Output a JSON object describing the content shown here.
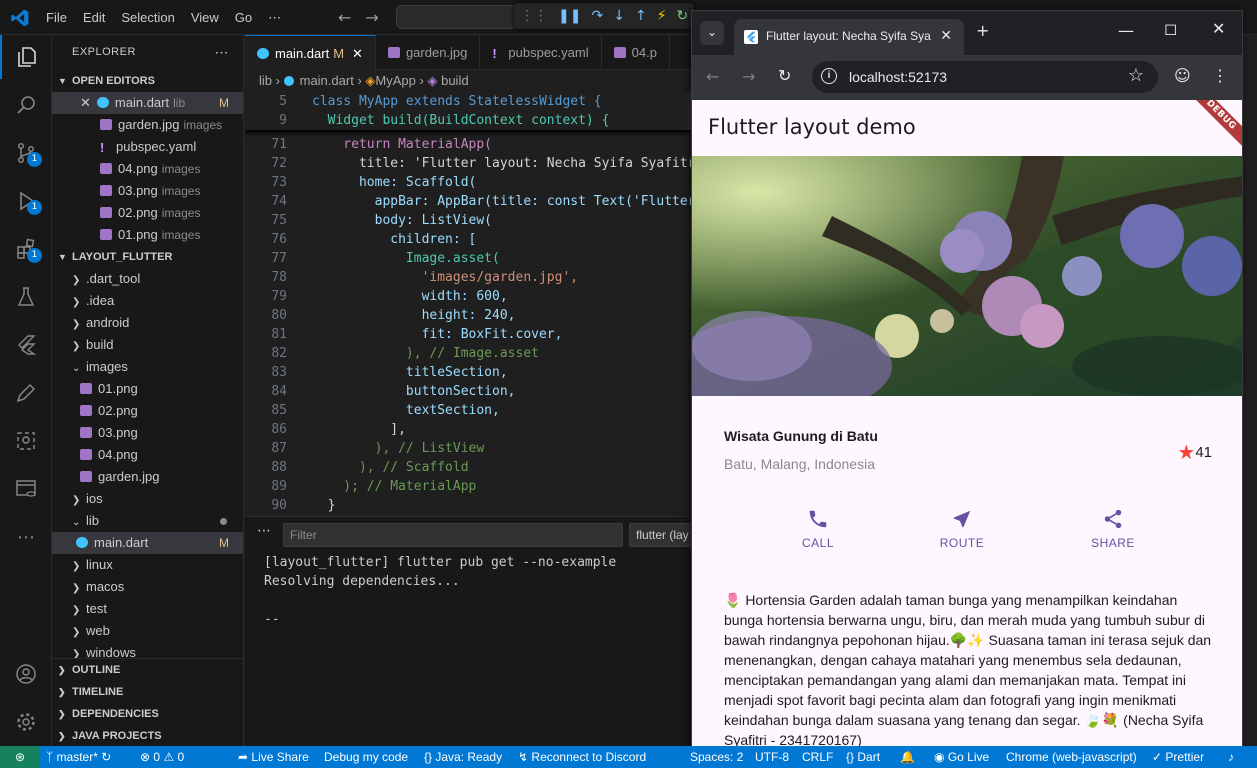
{
  "vscode": {
    "menu": [
      "File",
      "Edit",
      "Selection",
      "View",
      "Go",
      "⋯"
    ],
    "explorer_title": "EXPLORER",
    "open_editors": {
      "header": "OPEN EDITORS",
      "items": [
        {
          "name": "main.dart",
          "desc": "lib",
          "status": "M",
          "icon": "dart-icon"
        },
        {
          "name": "garden.jpg",
          "desc": "images",
          "icon": "image-icon"
        },
        {
          "name": "pubspec.yaml",
          "desc": "",
          "icon": "yaml-icon"
        },
        {
          "name": "04.png",
          "desc": "images",
          "icon": "image-icon"
        },
        {
          "name": "03.png",
          "desc": "images",
          "icon": "image-icon"
        },
        {
          "name": "02.png",
          "desc": "images",
          "icon": "image-icon"
        },
        {
          "name": "01.png",
          "desc": "images",
          "icon": "image-icon"
        }
      ]
    },
    "project": {
      "header": "LAYOUT_FLUTTER",
      "tree": [
        {
          "name": ".dart_tool",
          "type": "folder"
        },
        {
          "name": ".idea",
          "type": "folder"
        },
        {
          "name": "android",
          "type": "folder"
        },
        {
          "name": "build",
          "type": "folder"
        },
        {
          "name": "images",
          "type": "folder-open"
        },
        {
          "name": "01.png",
          "type": "image"
        },
        {
          "name": "02.png",
          "type": "image"
        },
        {
          "name": "03.png",
          "type": "image"
        },
        {
          "name": "04.png",
          "type": "image"
        },
        {
          "name": "garden.jpg",
          "type": "image"
        },
        {
          "name": "ios",
          "type": "folder"
        },
        {
          "name": "lib",
          "type": "folder-open"
        },
        {
          "name": "main.dart",
          "type": "dart",
          "status": "M"
        },
        {
          "name": "linux",
          "type": "folder"
        },
        {
          "name": "macos",
          "type": "folder"
        },
        {
          "name": "test",
          "type": "folder"
        },
        {
          "name": "web",
          "type": "folder"
        },
        {
          "name": "windows",
          "type": "folder"
        }
      ]
    },
    "bottom_sections": [
      "OUTLINE",
      "TIMELINE",
      "DEPENDENCIES",
      "JAVA PROJECTS"
    ],
    "badges": {
      "scm": "1",
      "debug": "1",
      "extensions": "1"
    },
    "tabs": [
      {
        "label": "main.dart",
        "status": "M",
        "active": true
      },
      {
        "label": "garden.jpg"
      },
      {
        "label": "pubspec.yaml"
      },
      {
        "label": "04.p"
      }
    ],
    "breadcrumb": [
      "lib",
      "main.dart",
      "MyApp",
      "build"
    ],
    "code_sticky": [
      {
        "ln": "5",
        "text": "class MyApp extends StatelessWidget {"
      },
      {
        "ln": "9",
        "text": "  Widget build(BuildContext context) {"
      }
    ],
    "code_lines": [
      {
        "ln": "71",
        "text": "    return MaterialApp("
      },
      {
        "ln": "72",
        "text": "      title: 'Flutter layout: Necha Syifa Syafitri"
      },
      {
        "ln": "73",
        "text": "      home: Scaffold("
      },
      {
        "ln": "74",
        "text": "        appBar: AppBar(title: const Text('Flutter"
      },
      {
        "ln": "75",
        "text": "        body: ListView("
      },
      {
        "ln": "76",
        "text": "          children: ["
      },
      {
        "ln": "77",
        "text": "            Image.asset("
      },
      {
        "ln": "78",
        "text": "              'images/garden.jpg',"
      },
      {
        "ln": "79",
        "text": "              width: 600,"
      },
      {
        "ln": "80",
        "text": "              height: 240,"
      },
      {
        "ln": "81",
        "text": "              fit: BoxFit.cover,"
      },
      {
        "ln": "82",
        "text": "            ), // Image.asset"
      },
      {
        "ln": "83",
        "text": "            titleSection,"
      },
      {
        "ln": "84",
        "text": "            buttonSection,"
      },
      {
        "ln": "85",
        "text": "            textSection,"
      },
      {
        "ln": "86",
        "text": "          ],"
      },
      {
        "ln": "87",
        "text": "        ), // ListView"
      },
      {
        "ln": "88",
        "text": "      ), // Scaffold"
      },
      {
        "ln": "89",
        "text": "    ); // MaterialApp"
      },
      {
        "ln": "90",
        "text": "  }"
      }
    ],
    "panel": {
      "filter_placeholder": "Filter",
      "select_value": "flutter (lay",
      "lines": [
        "[layout_flutter] flutter pub get --no-example",
        "Resolving dependencies...",
        "",
        "--"
      ]
    },
    "statusbar": {
      "branch": "master*",
      "errors": "0",
      "warnings": "0",
      "live_share": "Live Share",
      "debug": "Debug my code",
      "java": "Java: Ready",
      "discord": "Reconnect to Discord",
      "spaces": "Spaces: 2",
      "encoding": "UTF-8",
      "eol": "CRLF",
      "language": "Dart",
      "go_live": "Go Live",
      "device": "Chrome (web-javascript)",
      "prettier": "Prettier"
    }
  },
  "chrome": {
    "tab_title": "Flutter layout: Necha Syifa Syafitri",
    "url": "localhost:52173"
  },
  "flutter_app": {
    "appbar_title": "Flutter layout demo",
    "debug_banner": "DEBUG",
    "place_name": "Wisata Gunung di Batu",
    "location": "Batu, Malang, Indonesia",
    "rating": "41",
    "buttons": [
      {
        "label": "CALL",
        "icon": "phone-icon"
      },
      {
        "label": "ROUTE",
        "icon": "near-me-icon"
      },
      {
        "label": "SHARE",
        "icon": "share-icon"
      }
    ],
    "description": "🌷 Hortensia Garden adalah taman bunga yang menampilkan keindahan bunga hortensia berwarna ungu, biru, dan merah muda yang tumbuh subur di bawah rindangnya pepohonan hijau.🌳✨ Suasana taman ini terasa sejuk dan menenangkan, dengan cahaya matahari yang menembus sela dedaunan, menciptakan pemandangan yang alami dan memanjakan mata. Tempat ini menjadi spot favorit bagi pecinta alam dan fotografi yang ingin menikmati keindahan bunga dalam suasana yang tenang dan segar. 🍃💐 (Necha Syifa Syafitri - 2341720167)",
    "colors": {
      "primary": "#6750a4",
      "star": "#f44336",
      "background": "#fef7ff"
    }
  }
}
